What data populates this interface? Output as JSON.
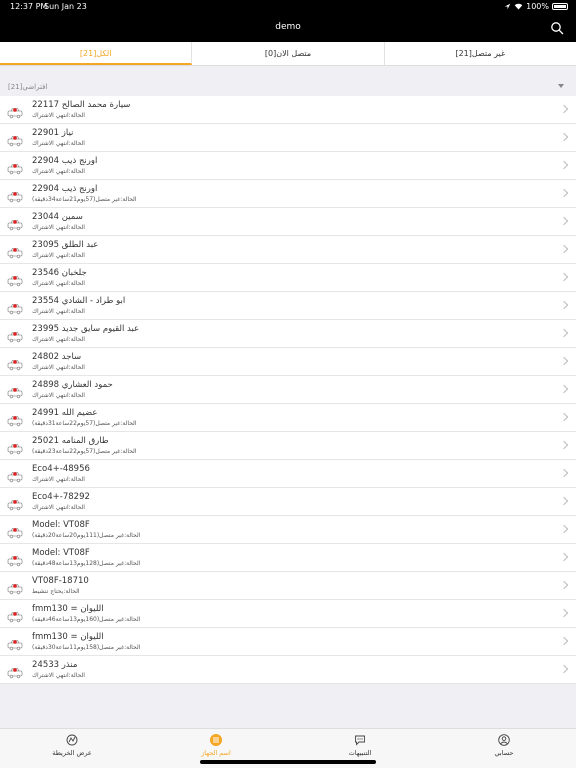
{
  "status": {
    "time": "12:37 PM",
    "date": "Sun Jan 23",
    "battery": "100%"
  },
  "header": {
    "title": "demo"
  },
  "segments": [
    {
      "label": "الكل[21]",
      "active": true
    },
    {
      "label": "متصل الان[0]",
      "active": false
    },
    {
      "label": "غير متصل[21]",
      "active": false
    }
  ],
  "group": {
    "name": "افتراضي[21]"
  },
  "devices": [
    {
      "title": "22117 سيارة محمد الصالح",
      "sub": "الحالة:انتهي الاشتراك"
    },
    {
      "title": "22901 نياز",
      "sub": "الحالة:انتهي الاشتراك"
    },
    {
      "title": "22904 اورنج ذيب",
      "sub": "الحالة:انتهي الاشتراك"
    },
    {
      "title": "22904 اورنج ذيب",
      "sub": "الحالة:غير متصل(57يوم21ساعة34دقيقة)"
    },
    {
      "title": "23044 سمين",
      "sub": "الحالة:انتهي الاشتراك"
    },
    {
      "title": "23095 عبد الطلق",
      "sub": "الحالة:انتهي الاشتراك"
    },
    {
      "title": "23546 جلخبان",
      "sub": "الحالة:انتهي الاشتراك"
    },
    {
      "title": "23554 ابو طراد - الشادي",
      "sub": "الحالة:انتهي الاشتراك"
    },
    {
      "title": "23995 عبد القيوم سايق جديد",
      "sub": "الحالة:انتهي الاشتراك"
    },
    {
      "title": "24802 ساجد",
      "sub": "الحالة:انتهي الاشتراك"
    },
    {
      "title": "24898 حمود العشاري",
      "sub": "الحالة:انتهي الاشتراك"
    },
    {
      "title": "24991 عضيم الله",
      "sub": "الحالة:غير متصل(57يوم22ساعة31دقيقة)"
    },
    {
      "title": "25021 طارق المنامه",
      "sub": "الحالة:غير متصل(57يوم22ساعة23دقيقة)"
    },
    {
      "title": "Eco4+-48956",
      "sub": "الحالة:انتهي الاشتراك"
    },
    {
      "title": "Eco4+-78292",
      "sub": "الحالة:انتهي الاشتراك"
    },
    {
      "title": "Model: VT08F",
      "sub": "الحالة:غير متصل(111يوم20ساعة20دقيقة)"
    },
    {
      "title": "Model: VT08F",
      "sub": "الحالة:غير متصل(128يوم13ساعة48دقيقة)"
    },
    {
      "title": "VT08F-18710",
      "sub": "الحالة:يحتاج تنشيط"
    },
    {
      "title": "fmm130 = الليوان",
      "sub": "الحالة:غير متصل(160يوم13ساعة46دقيقة)"
    },
    {
      "title": "fmm130 = الليوان",
      "sub": "الحالة:غير متصل(158يوم11ساعة30دقيقة)"
    },
    {
      "title": "24533 منذر",
      "sub": "الحالة:انتهي الاشتراك"
    }
  ],
  "tabs": [
    {
      "label": "عرض الخريطة",
      "icon": "map-icon",
      "active": false
    },
    {
      "label": "اسم الجهاز",
      "icon": "list-icon",
      "active": true
    },
    {
      "label": "التنبيهات",
      "icon": "chat-icon",
      "active": false
    },
    {
      "label": "حسابي",
      "icon": "user-icon",
      "active": false
    }
  ],
  "colors": {
    "accent": "#f5a623",
    "bar": "#000000"
  }
}
